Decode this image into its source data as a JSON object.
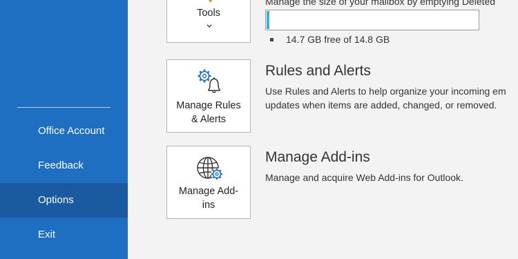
{
  "sidebar": {
    "items": [
      {
        "label": "Office Account",
        "active": false
      },
      {
        "label": "Feedback",
        "active": false
      },
      {
        "label": "Options",
        "active": true
      },
      {
        "label": "Exit",
        "active": false
      }
    ]
  },
  "tools": {
    "tile_label": "Tools",
    "description": "Manage the size of your mailbox by emptying Deleted",
    "storage_used_fraction": 0.007,
    "storage_text": "14.7 GB free of 14.8 GB"
  },
  "rules": {
    "tile_label_line1": "Manage Rules",
    "tile_label_line2": "& Alerts",
    "title": "Rules and Alerts",
    "description_line1": "Use Rules and Alerts to help organize your incoming em",
    "description_line2": "updates when items are added, changed, or removed."
  },
  "addins": {
    "tile_label_line1": "Manage Add-",
    "tile_label_line2": "ins",
    "title": "Manage Add-ins",
    "description": "Manage and acquire Web Add-ins for Outlook."
  },
  "colors": {
    "sidebar_bg": "#1e6fc1",
    "sidebar_active": "#195aa0",
    "accent": "#38b2d8",
    "icon_blue": "#1e6fc1"
  },
  "icons": {
    "tools": "tools-icon",
    "rules": "rules-alerts-icon",
    "addins": "globe-gear-icon",
    "chevron": "chevron-down-icon"
  }
}
